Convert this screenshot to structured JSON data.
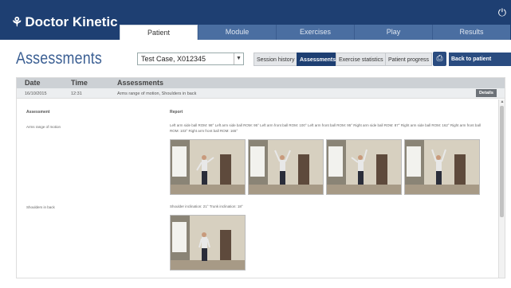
{
  "app": {
    "logo": "Doctor Kinetic",
    "tabs": [
      {
        "label": "Patient",
        "active": true
      },
      {
        "label": "Module",
        "active": false
      },
      {
        "label": "Exercises",
        "active": false
      },
      {
        "label": "Play",
        "active": false
      },
      {
        "label": "Results",
        "active": false
      }
    ]
  },
  "header": {
    "title": "Assessments",
    "patient_select": "Test Case, X012345",
    "buttons": {
      "session_history": "Session history",
      "assessments": "Assessments",
      "exercise_statistics": "Exercise statistics",
      "patient_progress": "Patient progress",
      "back": "Back to patient screen"
    }
  },
  "table": {
    "columns": {
      "date": "Date",
      "time": "Time",
      "assessments": "Assessments"
    },
    "row": {
      "date": "16/10/2015",
      "time": "12:31",
      "assessments": "Arms range of motion, Shoulders in back",
      "details": "Details"
    },
    "detail": {
      "assessment_header": "Assessment",
      "report_header": "Report",
      "items": [
        {
          "name": "Arms range of motion",
          "report": "Left arm side ball ROM: 98°   Left arm side ball ROM: 95°   Left arm front ball ROM: 100°   Left arm front ball ROM: 95°   Right arm side ball ROM: 87°   Right arm side ball ROM: 162°   Right arm front ball ROM: 103°   Right arm front ball ROM: 165°"
        },
        {
          "name": "Shoulders in back",
          "report": "Shoulder inclination: 21°   Trunk inclination: 18°"
        }
      ]
    }
  },
  "colors": {
    "topbar": "#1e3f72",
    "accent": "#3b5f93",
    "active_button": "#1e3f72"
  }
}
